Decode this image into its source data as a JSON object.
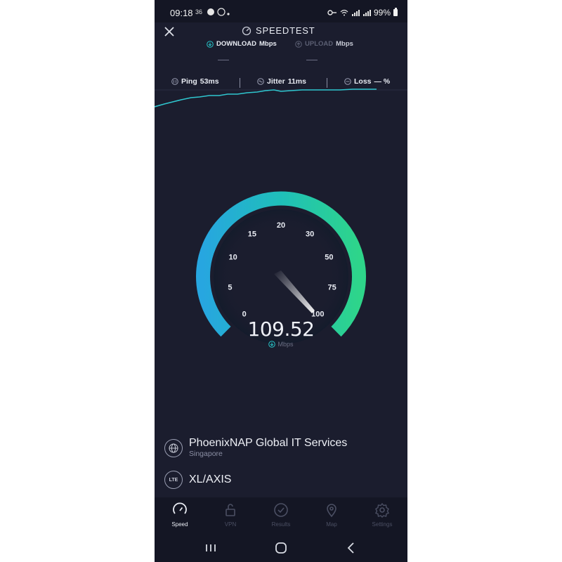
{
  "status": {
    "time": "09:18",
    "mini_a": "36",
    "battery": "99%"
  },
  "header": {
    "title": "SPEEDTEST"
  },
  "tabs": {
    "download": {
      "label": "DOWNLOAD",
      "unit": "Mbps",
      "value": "—"
    },
    "upload": {
      "label": "UPLOAD",
      "unit": "Mbps",
      "value": "—"
    }
  },
  "metrics": {
    "ping_label": "Ping",
    "ping_value": "53ms",
    "jitter_label": "Jitter",
    "jitter_value": "11ms",
    "loss_label": "Loss",
    "loss_value": "— %"
  },
  "gauge": {
    "ticks": [
      "0",
      "5",
      "10",
      "15",
      "20",
      "30",
      "50",
      "75",
      "100"
    ],
    "value": "109.52",
    "unit": "Mbps",
    "colors": {
      "start": "#27a6e0",
      "mid": "#1fbfb9",
      "end": "#2ed58a"
    }
  },
  "server": {
    "name": "PhoenixNAP Global IT Services",
    "location": "Singapore"
  },
  "provider": {
    "badge": "LTE",
    "name": "XL/AXIS"
  },
  "nav": {
    "items": [
      {
        "label": "Speed",
        "icon": "speed-gauge-icon",
        "active": true
      },
      {
        "label": "VPN",
        "icon": "lock-icon",
        "active": false
      },
      {
        "label": "Results",
        "icon": "checkmark-circle-icon",
        "active": false
      },
      {
        "label": "Map",
        "icon": "map-pin-icon",
        "active": false
      },
      {
        "label": "Settings",
        "icon": "gear-icon",
        "active": false
      }
    ]
  },
  "colors": {
    "accent": "#27c3c7",
    "background": "#1b1d2e",
    "bar": "#141624"
  }
}
